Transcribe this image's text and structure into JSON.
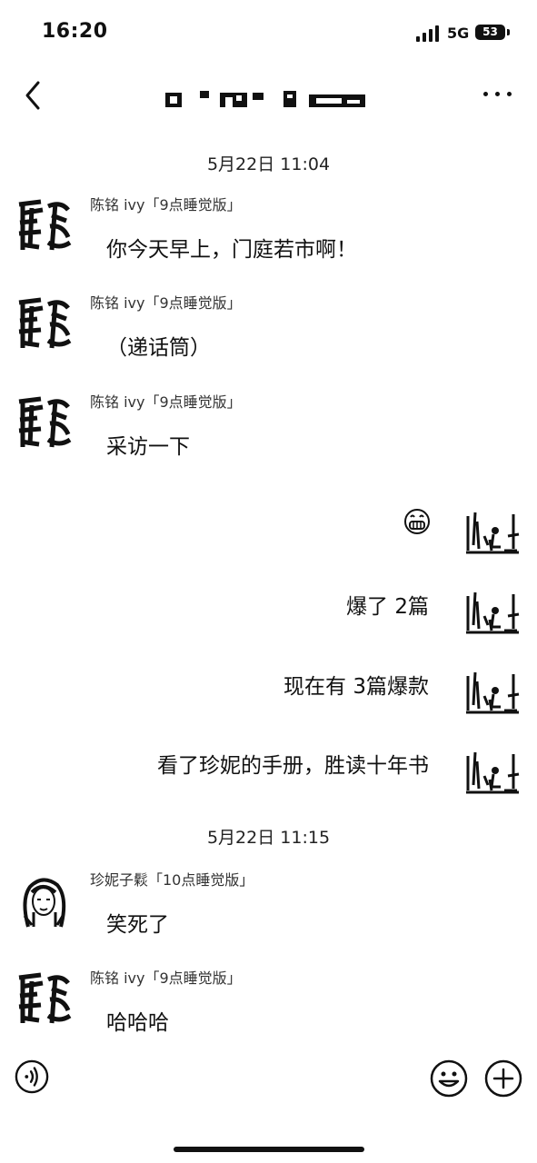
{
  "status_bar": {
    "time": "16:20",
    "network": "5G",
    "battery": "53"
  },
  "nav": {
    "title": "",
    "back_icon": "chevron-left-icon",
    "more_icon": "more-dots-icon"
  },
  "chat": {
    "timestamps": [
      "5月22日 11:04",
      "5月22日 11:15"
    ],
    "messages": [
      {
        "side": "left",
        "sender": "陈铭 ivy「9点睡觉版」",
        "text": "你今天早上，门庭若市啊！",
        "avatar": "calligraphy-avatar"
      },
      {
        "side": "left",
        "sender": "陈铭 ivy「9点睡觉版」",
        "text": "（递话筒）",
        "avatar": "calligraphy-avatar"
      },
      {
        "side": "left",
        "sender": "陈铭 ivy「9点睡觉版」",
        "text": "采访一下",
        "avatar": "calligraphy-avatar"
      },
      {
        "side": "right",
        "text": "",
        "emoji": "grin-emoji",
        "avatar": "landscape-avatar"
      },
      {
        "side": "right",
        "text": "爆了 2篇",
        "avatar": "landscape-avatar"
      },
      {
        "side": "right",
        "text": "现在有 3篇爆款",
        "avatar": "landscape-avatar"
      },
      {
        "side": "right",
        "text": "看了珍妮的手册，胜读十年书",
        "avatar": "landscape-avatar"
      },
      {
        "side": "left",
        "sender": "珍妮子鬏「10点睡觉版」",
        "text": "笑死了",
        "avatar": "portrait-avatar"
      },
      {
        "side": "left",
        "sender": "陈铭 ivy「9点睡觉版」",
        "text": "哈哈哈",
        "avatar": "calligraphy-avatar"
      }
    ]
  },
  "input_bar": {
    "voice_icon": "voice-icon",
    "emoji_icon": "emoji-icon",
    "add_icon": "add-icon"
  }
}
